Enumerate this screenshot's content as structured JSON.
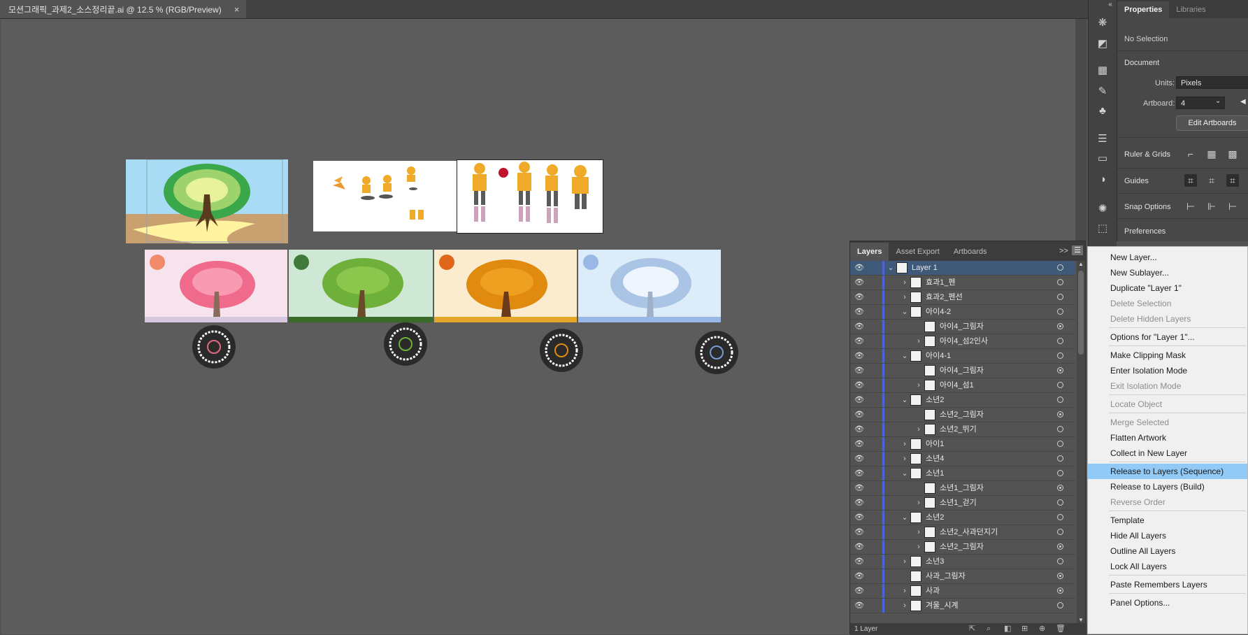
{
  "document": {
    "tab_title": "모션그래픽_과제2_소스정리끝.ai @ 12.5 % (RGB/Preview)",
    "close_glyph": "×"
  },
  "properties": {
    "tabs": [
      "Properties",
      "Libraries"
    ],
    "selection_status": "No Selection",
    "document_header": "Document",
    "units_label": "Units:",
    "units_value": "Pixels",
    "artboard_label": "Artboard:",
    "artboard_value": "4",
    "edit_artboards_button": "Edit Artboards",
    "ruler_grids_label": "Ruler & Grids",
    "guides_label": "Guides",
    "snap_options_label": "Snap Options",
    "preferences_label": "Preferences"
  },
  "layers_panel": {
    "tabs": [
      "Layers",
      "Asset Export",
      "Artboards"
    ],
    "more_glyph": ">>",
    "footer_status": "1 Layer",
    "rows": [
      {
        "name": "Layer 1",
        "level": 0,
        "expand": "open",
        "selected": true,
        "target": "ring"
      },
      {
        "name": "효과1_펜",
        "level": 1,
        "expand": "closed",
        "target": "ring"
      },
      {
        "name": "효과2_펜선",
        "level": 1,
        "expand": "closed",
        "target": "ring"
      },
      {
        "name": "아이4-2",
        "level": 1,
        "expand": "open",
        "target": "ring"
      },
      {
        "name": "아이4_그림자",
        "level": 2,
        "expand": "none",
        "target": "fill"
      },
      {
        "name": "아이4_섬2인사",
        "level": 2,
        "expand": "closed",
        "target": "ring"
      },
      {
        "name": "아이4-1",
        "level": 1,
        "expand": "open",
        "target": "ring"
      },
      {
        "name": "아이4_그림자",
        "level": 2,
        "expand": "none",
        "target": "fill"
      },
      {
        "name": "아이4_섬1",
        "level": 2,
        "expand": "closed",
        "target": "ring"
      },
      {
        "name": "소년2",
        "level": 1,
        "expand": "open",
        "target": "ring"
      },
      {
        "name": "소년2_그림자",
        "level": 2,
        "expand": "none",
        "target": "fill"
      },
      {
        "name": "소년2_뛰기",
        "level": 2,
        "expand": "closed",
        "target": "ring"
      },
      {
        "name": "아이1",
        "level": 1,
        "expand": "closed",
        "target": "ring"
      },
      {
        "name": "소년4",
        "level": 1,
        "expand": "closed",
        "target": "ring"
      },
      {
        "name": "소년1",
        "level": 1,
        "expand": "open",
        "target": "ring"
      },
      {
        "name": "소년1_그림자",
        "level": 2,
        "expand": "none",
        "target": "fill"
      },
      {
        "name": "소년1_걷기",
        "level": 2,
        "expand": "closed",
        "target": "ring"
      },
      {
        "name": "소년2",
        "level": 1,
        "expand": "open",
        "target": "ring"
      },
      {
        "name": "소년2_사과던지기",
        "level": 2,
        "expand": "closed",
        "target": "ring"
      },
      {
        "name": "소년2_그림자",
        "level": 2,
        "expand": "closed",
        "target": "fill"
      },
      {
        "name": "소년3",
        "level": 1,
        "expand": "closed",
        "target": "ring"
      },
      {
        "name": "사과_그림자",
        "level": 1,
        "expand": "none",
        "target": "fill"
      },
      {
        "name": "사과",
        "level": 1,
        "expand": "closed",
        "target": "fill"
      },
      {
        "name": "겨울_시계",
        "level": 1,
        "expand": "closed",
        "target": "ring"
      }
    ]
  },
  "context_menu": {
    "groups": [
      [
        {
          "label": "New Layer...",
          "enabled": true
        },
        {
          "label": "New Sublayer...",
          "enabled": true
        },
        {
          "label": "Duplicate \"Layer 1\"",
          "enabled": true
        },
        {
          "label": "Delete Selection",
          "enabled": false
        },
        {
          "label": "Delete Hidden Layers",
          "enabled": false
        }
      ],
      [
        {
          "label": "Options for \"Layer 1\"...",
          "enabled": true
        }
      ],
      [
        {
          "label": "Make Clipping Mask",
          "enabled": true
        },
        {
          "label": "Enter Isolation Mode",
          "enabled": true
        },
        {
          "label": "Exit Isolation Mode",
          "enabled": false
        }
      ],
      [
        {
          "label": "Locate Object",
          "enabled": false
        }
      ],
      [
        {
          "label": "Merge Selected",
          "enabled": false
        },
        {
          "label": "Flatten Artwork",
          "enabled": true
        },
        {
          "label": "Collect in New Layer",
          "enabled": true
        }
      ],
      [
        {
          "label": "Release to Layers (Sequence)",
          "enabled": true,
          "highlighted": true
        },
        {
          "label": "Release to Layers (Build)",
          "enabled": true
        },
        {
          "label": "Reverse Order",
          "enabled": false
        }
      ],
      [
        {
          "label": "Template",
          "enabled": true
        },
        {
          "label": "Hide All Layers",
          "enabled": true
        },
        {
          "label": "Outline All Layers",
          "enabled": true
        },
        {
          "label": "Lock All Layers",
          "enabled": true
        }
      ],
      [
        {
          "label": "Paste Remembers Layers",
          "enabled": true
        }
      ],
      [
        {
          "label": "Panel Options...",
          "enabled": true
        }
      ]
    ]
  },
  "colors": {
    "selection_row": "#3e5a78",
    "layer_color_bar": "#4d63d8",
    "menu_highlight": "#91c9f7"
  },
  "icons": {
    "eye": "eye-icon",
    "expand": "chevron-right-icon",
    "collapse": "chevron-down-icon",
    "panel_menu": "hamburger-menu-icon"
  }
}
